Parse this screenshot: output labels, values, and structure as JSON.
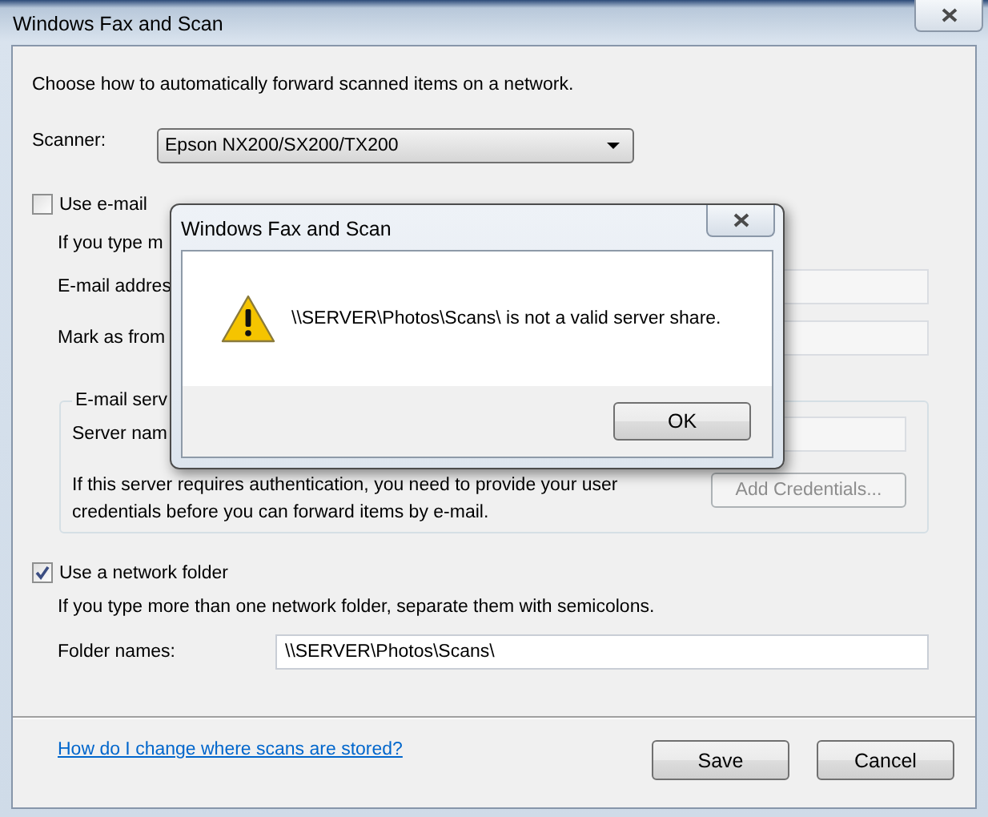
{
  "window": {
    "title": "Windows Fax and Scan"
  },
  "intro": "Choose how to automatically forward scanned items on a network.",
  "scanner": {
    "label": "Scanner:",
    "value": "Epson NX200/SX200/TX200"
  },
  "email": {
    "label": "Use e-mail",
    "checked": false,
    "hint": "If you type m",
    "address_label": "E-mail addres",
    "from_label": "Mark as from",
    "server_group": {
      "title": "E-mail serv",
      "server_label": "Server nam",
      "auth_text": "If this server requires authentication, you need to provide your user credentials before you can forward items by e-mail.",
      "credentials_button": {
        "label": "Add Credentials...",
        "disabled": true
      }
    }
  },
  "network_folder": {
    "label": "Use a network folder",
    "checked": true,
    "hint": "If you type more than one network folder, separate them with semicolons.",
    "folder_label": "Folder names:",
    "folder_value": "\\\\SERVER\\Photos\\Scans\\"
  },
  "help_link": "How do I change where scans are stored?",
  "buttons": [
    "Save",
    "Cancel"
  ],
  "dialog": {
    "title": "Windows Fax and Scan",
    "message": "\\\\SERVER\\Photos\\Scans\\ is not a valid server share.",
    "buttons": [
      "OK"
    ]
  }
}
